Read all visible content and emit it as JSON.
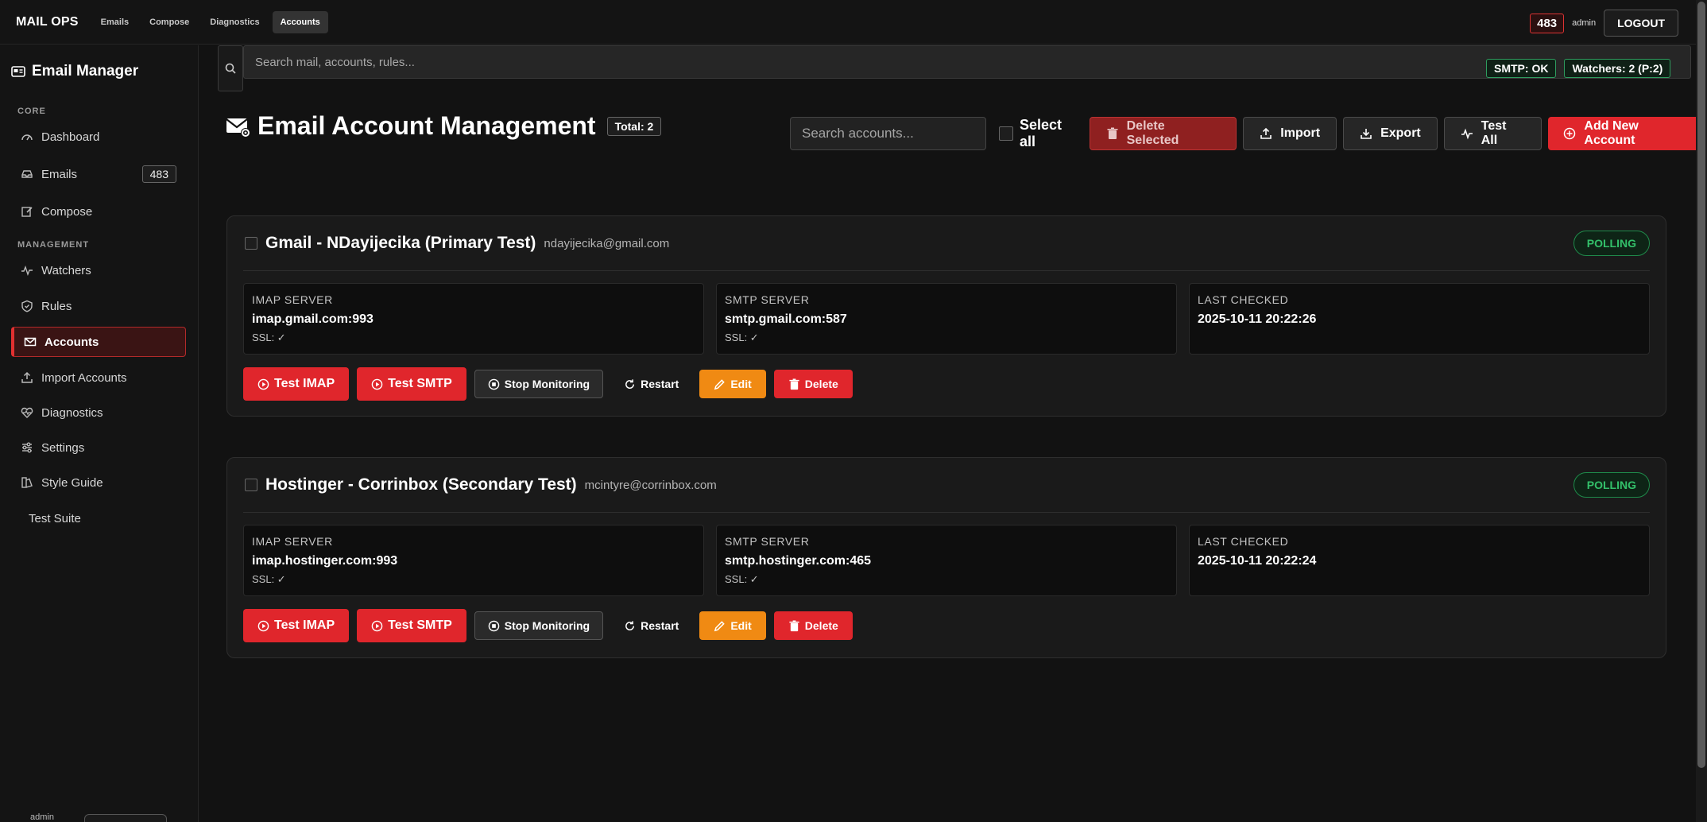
{
  "topbar": {
    "brand": "MAIL OPS",
    "nav": [
      "Emails",
      "Compose",
      "Diagnostics",
      "Accounts"
    ],
    "active_nav": "Accounts",
    "email_count": "483",
    "user": "admin",
    "logout_label": "LOGOUT"
  },
  "sidebar": {
    "title": "Email Manager",
    "sections": {
      "core": "CORE",
      "management": "MANAGEMENT"
    },
    "items": [
      {
        "label": "Dashboard",
        "icon": "dashboard-icon"
      },
      {
        "label": "Emails",
        "icon": "inbox-icon",
        "badge": "483"
      },
      {
        "label": "Compose",
        "icon": "compose-icon"
      },
      {
        "label": "Watchers",
        "icon": "activity-icon"
      },
      {
        "label": "Rules",
        "icon": "shield-icon"
      },
      {
        "label": "Accounts",
        "icon": "envelope-icon",
        "active": true
      },
      {
        "label": "Import Accounts",
        "icon": "upload-icon"
      },
      {
        "label": "Diagnostics",
        "icon": "heart-pulse-icon"
      },
      {
        "label": "Settings",
        "icon": "sliders-icon"
      },
      {
        "label": "Style Guide",
        "icon": "palette-icon"
      },
      {
        "label": "Test Suite",
        "icon": ""
      }
    ],
    "footer_user": "admin"
  },
  "search": {
    "placeholder": "Search mail, accounts, rules..."
  },
  "status": {
    "smtp": "SMTP: OK",
    "watchers": "Watchers: 2 (P:2)"
  },
  "page": {
    "title": "Email Account Management",
    "total": "Total: 2",
    "account_search_placeholder": "Search accounts...",
    "select_all": "Select all",
    "buttons": {
      "delete_selected": "Delete Selected",
      "import": "Import",
      "export": "Export",
      "test_all": "Test All",
      "add_new": "Add New Account"
    }
  },
  "labels": {
    "imap_server": "IMAP SERVER",
    "smtp_server": "SMTP SERVER",
    "last_checked": "LAST CHECKED",
    "test_imap": "Test IMAP",
    "test_smtp": "Test SMTP",
    "stop_monitoring": "Stop Monitoring",
    "restart": "Restart",
    "edit": "Edit",
    "delete": "Delete"
  },
  "accounts": [
    {
      "name": "Gmail - NDayijecika (Primary Test)",
      "email": "ndayijecika@gmail.com",
      "status": "POLLING",
      "imap": "imap.gmail.com:993",
      "imap_ssl": "SSL: ✓",
      "smtp": "smtp.gmail.com:587",
      "smtp_ssl": "SSL: ✓",
      "last_checked": "2025-10-11 20:22:26"
    },
    {
      "name": "Hostinger - Corrinbox (Secondary Test)",
      "email": "mcintyre@corrinbox.com",
      "status": "POLLING",
      "imap": "imap.hostinger.com:993",
      "imap_ssl": "SSL: ✓",
      "smtp": "smtp.hostinger.com:465",
      "smtp_ssl": "SSL: ✓",
      "last_checked": "2025-10-11 20:22:24"
    }
  ],
  "colors": {
    "accent_red": "#e0262c",
    "edit_orange": "#f08a13",
    "status_green": "#33c06a",
    "background": "#121212"
  }
}
